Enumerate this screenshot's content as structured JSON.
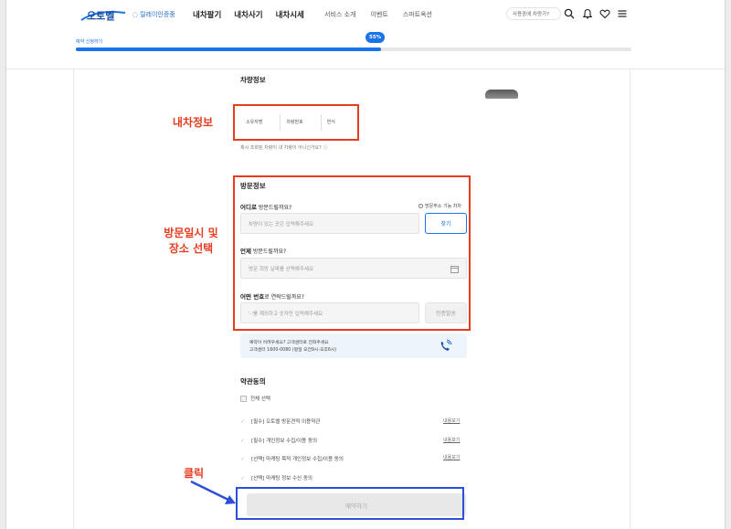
{
  "header": {
    "logo_text": "오토벨",
    "sub_logo": "릴레이인증중",
    "nav_main": [
      "내차팔기",
      "내차사기",
      "내차시세"
    ],
    "nav_sub": [
      "서비스 소개",
      "이벤트",
      "스마트옥션"
    ],
    "search_placeholder": "사용중에 차량가?",
    "icons": [
      "search-icon",
      "bell-icon",
      "heart-icon",
      "menu-icon"
    ]
  },
  "progress": {
    "label": "예약 신청하기",
    "percent_label": "55%",
    "percent": 55,
    "accent": "#1a73e8"
  },
  "vehicle_info": {
    "title": "차량정보",
    "cells": [
      "소유자명",
      "차량번호",
      "연식"
    ],
    "note": "혹시 조회된 차량이 내 차량이 아니신가요?"
  },
  "visit_info": {
    "title": "방문정보",
    "where_label_bold": "어디로",
    "where_label_rest": " 방문드릴까요?",
    "unknown_option": "방문주소 기능 차차",
    "address_placeholder": "차량이 있는 곳은 입력해주세요",
    "search_button": "찾기",
    "when_label_bold": "언제",
    "when_label_rest": " 방문드릴까요?",
    "date_placeholder": "방문 희망 날짜를 선택해주세요",
    "phone_label_bold": "어떤 번호",
    "phone_label_rest": "로 연락드릴까요?",
    "phone_placeholder": "'-'를 제외하고 숫자만 입력해주세요",
    "verify_button": "인증발송"
  },
  "call_banner": {
    "line1": "예약이 어려우세요? 고객센터로 전화주세요",
    "line2": "고객센터 1600-0080 (평일 오전9시-오후6시)"
  },
  "terms": {
    "title": "약관동의",
    "select_all": "전체 선택",
    "items": [
      {
        "label": "[필수] 오토벨 방문견적 이용약관",
        "link": "내용보기"
      },
      {
        "label": "[필수] 개인정보 수집/이용 동의",
        "link": "내용보기"
      },
      {
        "label": "[선택] 마케팅 목적 개인정보 수집/이용 동의",
        "link": "내용보기"
      },
      {
        "label": "[선택] 마케팅 정보 수신 동의",
        "link": ""
      }
    ]
  },
  "reserve_button": "예약하기",
  "annotations": {
    "vehicle": "내차정보",
    "visit_line1": "방문일시 및",
    "visit_line2": "장소 선택",
    "click": "클릭"
  },
  "colors": {
    "annotation_red": "#e63b1e",
    "annotation_blue": "#2b4fd8"
  }
}
